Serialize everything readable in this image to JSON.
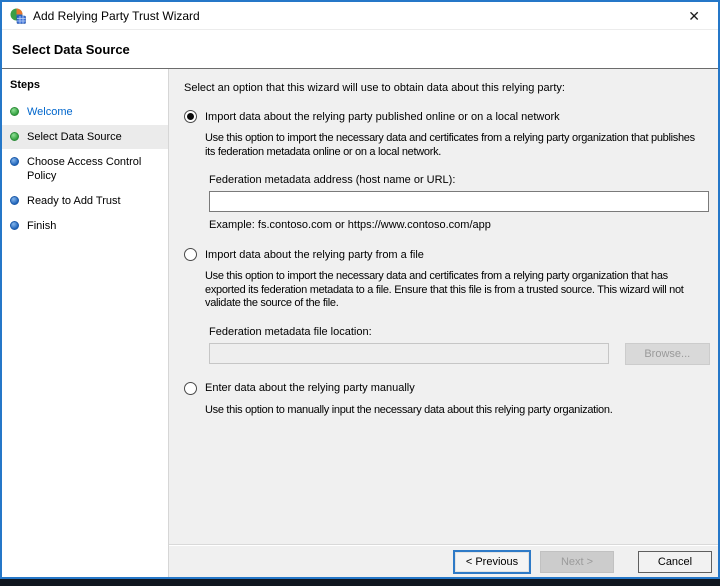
{
  "window": {
    "title": "Add Relying Party Trust Wizard",
    "close_glyph": "✕"
  },
  "header": {
    "title": "Select Data Source"
  },
  "sidebar": {
    "title": "Steps",
    "items": [
      {
        "label": "Welcome",
        "state": "done",
        "active": false,
        "link": true
      },
      {
        "label": "Select Data Source",
        "state": "done",
        "active": true,
        "link": false
      },
      {
        "label": "Choose Access Control Policy",
        "state": "todo",
        "active": false,
        "link": false
      },
      {
        "label": "Ready to Add Trust",
        "state": "todo",
        "active": false,
        "link": false
      },
      {
        "label": "Finish",
        "state": "todo",
        "active": false,
        "link": false
      }
    ]
  },
  "content": {
    "intro": "Select an option that this wizard will use to obtain data about this relying party:",
    "options": [
      {
        "label": "Import data about the relying party published online or on a local network",
        "selected": true,
        "description": "Use this option to import the necessary data and certificates from a relying party organization that publishes\nits federation metadata online or on a local network.",
        "field_label": "Federation metadata address (host name or URL):",
        "field_value": "",
        "example": "Example: fs.contoso.com or https://www.contoso.com/app"
      },
      {
        "label": "Import data about the relying party from a file",
        "selected": false,
        "description": "Use this option to import the necessary data and certificates from a relying party organization that has\nexported its federation metadata to a file. Ensure that this file is from a trusted source.  This wizard will not\nvalidate the source of the file.",
        "field_label": "Federation metadata file location:",
        "field_value": "",
        "browse_label": "Browse..."
      },
      {
        "label": "Enter data about the relying party manually",
        "selected": false,
        "description": "Use this option to manually input the necessary data about this relying party organization."
      }
    ]
  },
  "footer": {
    "previous_label": "< Previous",
    "next_label": "Next >",
    "cancel_label": "Cancel"
  },
  "colors": {
    "accent_border": "#2577c8",
    "done_bullet": "#2f9e3c",
    "todo_bullet": "#1d62b8",
    "link_text": "#0066cc",
    "content_bg": "#f0f0f0",
    "active_step_bg": "#ebebeb"
  }
}
